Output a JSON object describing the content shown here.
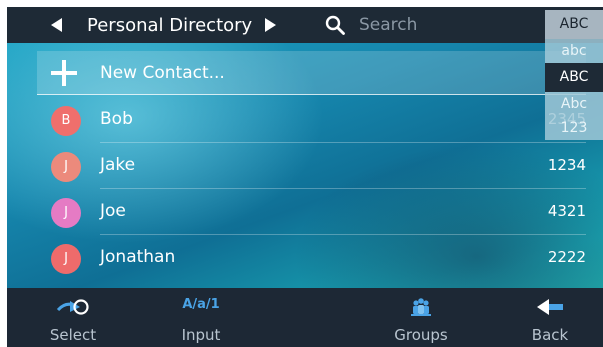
{
  "header": {
    "title": "Personal Directory",
    "search_placeholder": "Search"
  },
  "new_contact": {
    "label": "New Contact..."
  },
  "contacts": [
    {
      "initial": "B",
      "name": "Bob",
      "number": "2345",
      "avatar_color": "#ef6f6c"
    },
    {
      "initial": "J",
      "name": "Jake",
      "number": "1234",
      "avatar_color": "#ec8a7c"
    },
    {
      "initial": "J",
      "name": "Joe",
      "number": "4321",
      "avatar_color": "#e57bc4"
    },
    {
      "initial": "J",
      "name": "Jonathan",
      "number": "2222",
      "avatar_color": "#ee6b6b"
    }
  ],
  "alpha_panel": {
    "items": [
      "ABC",
      "abc",
      "ABC",
      "Abc",
      "123"
    ],
    "selected": "ABC"
  },
  "footer": {
    "select": {
      "label": "Select",
      "icon": "select-arrow-icon"
    },
    "input": {
      "label": "Input",
      "mode": "A/a/1",
      "icon": "input-mode-icon"
    },
    "groups": {
      "label": "Groups",
      "icon": "groups-icon"
    },
    "back": {
      "label": "Back",
      "icon": "back-arrow-icon"
    }
  },
  "colors": {
    "header_bg": "#1e2a36",
    "accent_blue": "#4aa3e6",
    "footer_bg": "#1d2835"
  }
}
